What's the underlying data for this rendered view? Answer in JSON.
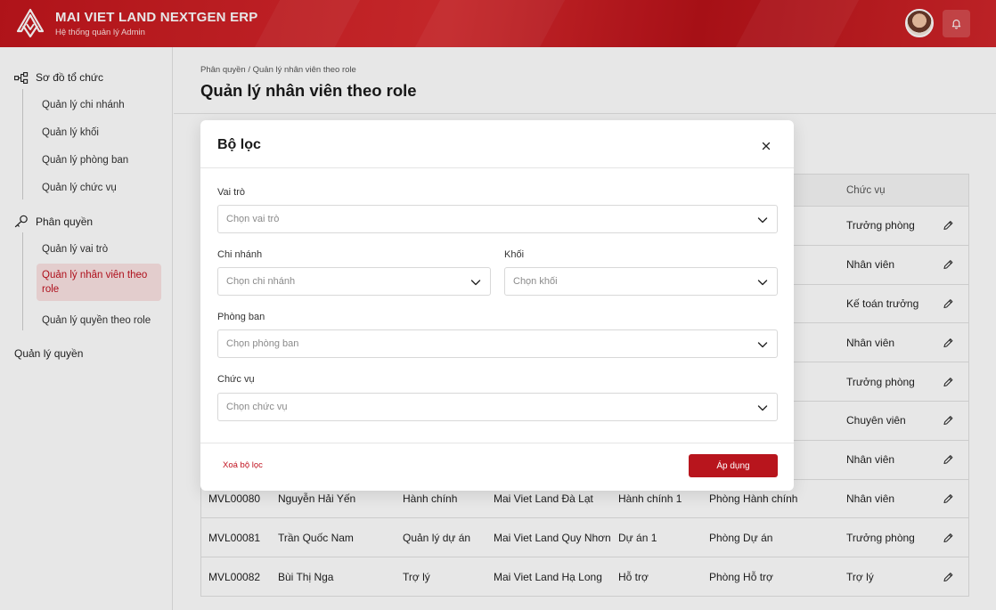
{
  "header": {
    "brand_title": "MAI VIET LAND NEXTGEN ERP",
    "brand_subtitle": "Hệ thống quản lý Admin"
  },
  "sidebar": {
    "groups": [
      {
        "label": "Sơ đồ tổ chức",
        "icon": "org-chart-icon",
        "items": [
          "Quản lý chi nhánh",
          "Quản lý khối",
          "Quản lý phòng ban",
          "Quản lý chức vụ"
        ]
      },
      {
        "label": "Phân quyền",
        "icon": "key-icon",
        "items": [
          "Quản lý vai trò",
          "Quản lý nhân viên theo role",
          "Quản lý quyền theo role"
        ]
      },
      {
        "label": "Quản lý quyền"
      }
    ],
    "active_item": "Quản lý nhân viên theo role"
  },
  "main": {
    "breadcrumb": "Phân quyền / Quản lý nhân viên theo role",
    "title": "Quản lý nhân viên theo role",
    "table": {
      "visible_header": "Chức vụ",
      "rows": [
        {
          "cells": [
            "",
            "",
            "",
            "",
            "",
            "",
            "Trưởng phòng"
          ]
        },
        {
          "cells": [
            "",
            "",
            "",
            "",
            "",
            "",
            "Nhân viên"
          ]
        },
        {
          "cells": [
            "",
            "",
            "",
            "",
            "",
            "",
            "Kế toán trưởng"
          ]
        },
        {
          "cells": [
            "",
            "",
            "",
            "",
            "",
            "",
            "Nhân viên"
          ]
        },
        {
          "cells": [
            "",
            "",
            "",
            "",
            "",
            "",
            "Trưởng phòng"
          ]
        },
        {
          "cells": [
            "",
            "",
            "",
            "",
            "",
            "",
            "Chuyên viên"
          ]
        },
        {
          "cells": [
            "",
            "",
            "",
            "",
            "",
            "",
            "Nhân viên"
          ]
        },
        {
          "cells": [
            "MVL00080",
            "Nguyễn Hải Yến",
            "Hành chính",
            "Mai Viet Land Đà Lạt",
            "Hành chính 1",
            "Phòng Hành chính",
            "Nhân viên"
          ]
        },
        {
          "cells": [
            "MVL00081",
            "Trần Quốc Nam",
            "Quản lý dự án",
            "Mai Viet Land Quy Nhơn",
            "Dự án 1",
            "Phòng Dự án",
            "Trưởng phòng"
          ]
        },
        {
          "cells": [
            "MVL00082",
            "Bùi Thị Nga",
            "Trợ lý",
            "Mai Viet Land Hạ Long",
            "Hỗ trợ",
            "Phòng Hỗ trợ",
            "Trợ lý"
          ]
        }
      ]
    }
  },
  "modal": {
    "title": "Bộ lọc",
    "fields": {
      "role": {
        "label": "Vai trò",
        "placeholder": "Chọn vai trò"
      },
      "branch": {
        "label": "Chi nhánh",
        "placeholder": "Chọn chi nhánh"
      },
      "block": {
        "label": "Khối",
        "placeholder": "Chọn khối"
      },
      "department": {
        "label": "Phòng ban",
        "placeholder": "Chọn phòng ban"
      },
      "position": {
        "label": "Chức vụ",
        "placeholder": "Chọn chức vụ"
      }
    },
    "clear_label": "Xoá bộ lọc",
    "apply_label": "Áp dụng"
  },
  "colors": {
    "brand": "#c8181e",
    "active_bg": "#fbe3e3",
    "active_text": "#c1121f"
  }
}
